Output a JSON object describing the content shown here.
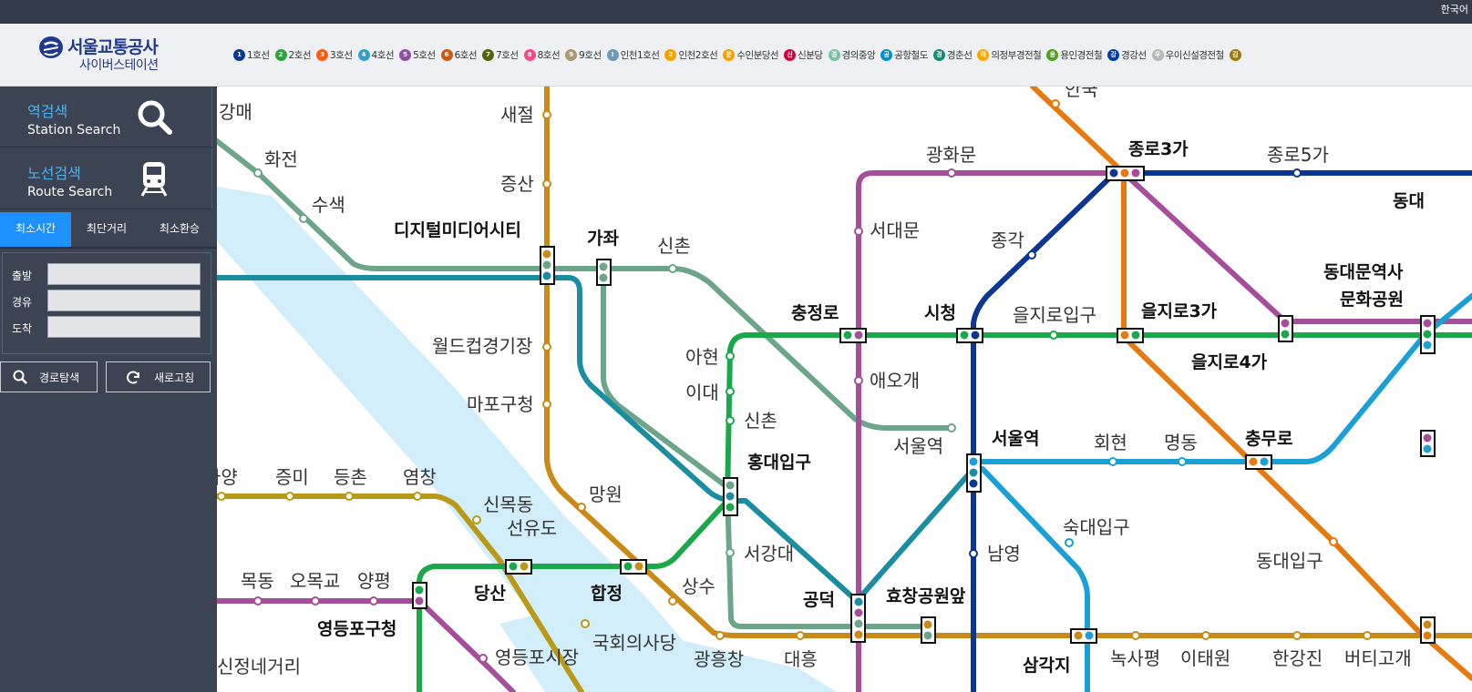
{
  "topbar": {
    "language": "한국어"
  },
  "logo": {
    "main": "서울교통공사",
    "sub": "사이버스테이션"
  },
  "colors": {
    "topbar": "#343b4b",
    "sidebar": "#3c4353",
    "accent": "#1e90ff",
    "side_text": "#4cb3f5"
  },
  "legend": [
    {
      "badge": "1",
      "name": "1호선",
      "color": "#0d3692"
    },
    {
      "badge": "2",
      "name": "2호선",
      "color": "#33a23d"
    },
    {
      "badge": "3",
      "name": "3호선",
      "color": "#fe5b10"
    },
    {
      "badge": "4",
      "name": "4호선",
      "color": "#32a1c8"
    },
    {
      "badge": "5",
      "name": "5호선",
      "color": "#8b50a4"
    },
    {
      "badge": "6",
      "name": "6호선",
      "color": "#c55c1d"
    },
    {
      "badge": "7",
      "name": "7호선",
      "color": "#54640d"
    },
    {
      "badge": "8",
      "name": "8호선",
      "color": "#f14c82"
    },
    {
      "badge": "9",
      "name": "9호선",
      "color": "#aa9872"
    },
    {
      "badge": "I",
      "name": "인천1호선",
      "color": "#6e98bb"
    },
    {
      "badge": "2",
      "name": "인천2호선",
      "color": "#f5a200"
    },
    {
      "badge": "분",
      "name": "수인분당선",
      "color": "#f5a200"
    },
    {
      "badge": "신",
      "name": "신분당",
      "color": "#d4003b"
    },
    {
      "badge": "경",
      "name": "경의중앙",
      "color": "#77c4a3"
    },
    {
      "badge": "공",
      "name": "공항철도",
      "color": "#0090d2"
    },
    {
      "badge": "경",
      "name": "경춘선",
      "color": "#0c8e72"
    },
    {
      "badge": "의",
      "name": "의정부경전철",
      "color": "#fda600"
    },
    {
      "badge": "용",
      "name": "용인경전철",
      "color": "#509f22"
    },
    {
      "badge": "강",
      "name": "경강선",
      "color": "#003da5"
    },
    {
      "badge": "우",
      "name": "우이신설경전철",
      "color": "#b7b7b7"
    },
    {
      "badge": "김",
      "name": "",
      "color": "#a17800"
    }
  ],
  "sidebar": {
    "station_search": {
      "ko": "역검색",
      "en": "Station Search"
    },
    "route_search": {
      "ko": "노선검색",
      "en": "Route Search"
    },
    "tabs": [
      {
        "label": "최소시간",
        "active": true
      },
      {
        "label": "최단거리",
        "active": false
      },
      {
        "label": "최소환승",
        "active": false
      }
    ],
    "form": {
      "departure_label": "출발",
      "via_label": "경유",
      "arrival_label": "도착",
      "departure_value": "",
      "via_value": "",
      "arrival_value": ""
    },
    "search_button": "경로탐색",
    "refresh_button": "새로고침"
  },
  "map": {
    "line_colors": {
      "l1": "#0d3692",
      "l2": "#1aa84a",
      "l3": "#e57a10",
      "l4": "#1aa0d4",
      "l5": "#a54e9c",
      "l6": "#c98a17",
      "l9": "#b89a18",
      "gyeongui": "#6da58a",
      "airport": "#1a8ea0",
      "river": "#cfeef9"
    },
    "stations": {
      "gangmae": "강매",
      "hwajeon": "화전",
      "susaek": "수색",
      "dmc": "디지털미디어시티",
      "gajwa": "가좌",
      "sinchon_gy": "신촌",
      "saejeol": "새절",
      "jeungsan": "증산",
      "worldcup": "월드컵경기장",
      "mapo_office": "마포구청",
      "mangwon": "망원",
      "hapjeong": "합정",
      "sangsu": "상수",
      "gwangheungchang": "광흥창",
      "daeheung": "대흥",
      "gongdeok": "공덕",
      "hyochang": "효창공원앞",
      "samgakji": "삼각지",
      "noksapyeong": "녹사평",
      "itaewon": "이태원",
      "hangangjin": "한강진",
      "beotigogae": "버티고개",
      "hongik": "홍대입구",
      "sinchon2": "신촌",
      "ewha": "이대",
      "ahyeon": "아현",
      "chungjeongno": "충정로",
      "cityhall": "시청",
      "euljiro1": "을지로입구",
      "euljiro3": "을지로3가",
      "euljiro4": "을지로4가",
      "ddp": "동대문역사",
      "ddp2": "문화공원",
      "dongdaemun": "동대",
      "jongno3": "종로3가",
      "jongno5": "종로5가",
      "jonggak": "종각",
      "gwanghwamun": "광화문",
      "seodaemun": "서대문",
      "aeogae": "애오개",
      "seoulstation": "서울역",
      "seoul_gy": "서울역",
      "hoehyeon": "회현",
      "myeongdong": "명동",
      "chungmuro": "충무로",
      "sookmyung": "숙대입구",
      "namyeong": "남영",
      "dongguk": "동대입구",
      "anguk": "안국",
      "seogang": "서강대",
      "dangsan": "당산",
      "seonyudo": "선유도",
      "sinmokdong": "신목동",
      "yeomchang": "염창",
      "deungchon": "등촌",
      "jeungmi": "증미",
      "gayang": "가양",
      "mokdong": "목동",
      "omokgyo": "오목교",
      "yangpyeong": "양평",
      "yeongdeungpo_office": "영등포구청",
      "yeongdeungpo_market": "영등포시장",
      "assembly": "국회의사당",
      "singil": "신정네거리"
    }
  }
}
